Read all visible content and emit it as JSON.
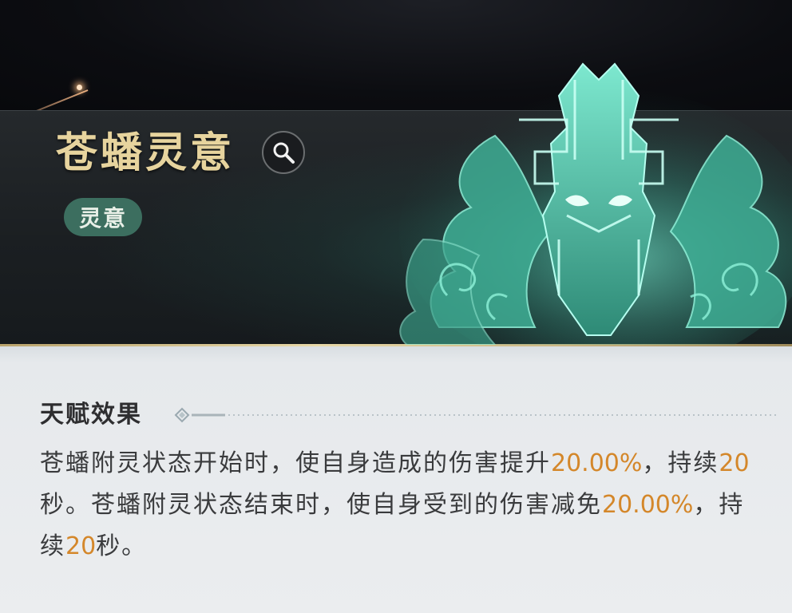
{
  "talent": {
    "name": "苍蟠灵意",
    "tag": "灵意",
    "search_icon": "magnifier-icon"
  },
  "effect": {
    "section_title": "天赋效果",
    "description_parts": [
      {
        "text": "苍蟠附灵状态开始时，使自身造成的伤害提升",
        "highlight": false
      },
      {
        "text": "20.00%",
        "highlight": true
      },
      {
        "text": "，持续",
        "highlight": false
      },
      {
        "text": "20",
        "highlight": true
      },
      {
        "text": "秒。苍蟠附灵状态结束时，使自身受到的伤害减免",
        "highlight": false
      },
      {
        "text": "20.00%",
        "highlight": true
      },
      {
        "text": "，持续",
        "highlight": false
      },
      {
        "text": "20",
        "highlight": true
      },
      {
        "text": "秒。",
        "highlight": false
      }
    ]
  },
  "colors": {
    "title_gold": "#e7d49e",
    "tag_green": "#3c6e5f",
    "highlight_orange": "#d4872a",
    "emblem_teal": "#5fd8be"
  }
}
